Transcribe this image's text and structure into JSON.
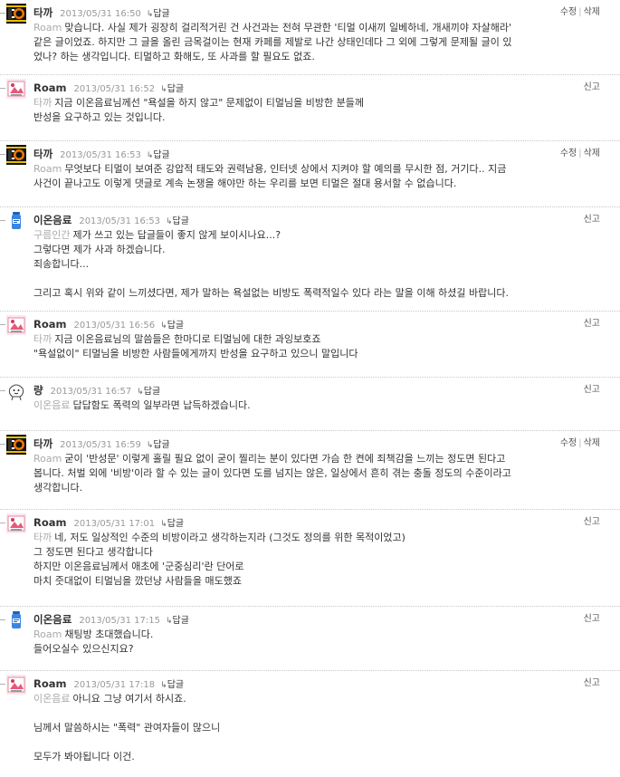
{
  "comments": [
    {
      "nick": "타까",
      "avatar": "taka-avatar",
      "date": "2013/05/31 16:50",
      "reply": "답글",
      "actions": [
        "수정",
        "삭제"
      ],
      "ref": "Roam",
      "lines": [
        "맞습니다. 사실 제가 굉장히 걸리적거린 건 사건과는 전혀 무관한 '티멀 이새끼 일베하네, 개새끼야 자살해라'",
        "같은 글이었죠. 하지만 그 글을 올린 금목걸이는 현재 카페를 제발로 나간 상태인데다 그 외에 그렇게 문제될 글이 있",
        "었나? 하는 생각입니다. 티멀하고 화해도, 또 사과를 할 필요도 없죠."
      ]
    },
    {
      "nick": "Roam",
      "avatar": "roam-avatar",
      "date": "2013/05/31 16:52",
      "reply": "답글",
      "actions": [
        "신고"
      ],
      "ref": "타까",
      "lines": [
        "지금 이온음료님께선 \"욕설을 하지 않고\" 문제없이 티멀님을 비방한 분들께",
        "반성을 요구하고 있는 것입니다."
      ]
    },
    {
      "nick": "타까",
      "avatar": "taka-avatar",
      "date": "2013/05/31 16:53",
      "reply": "답글",
      "actions": [
        "수정",
        "삭제"
      ],
      "ref": "Roam",
      "lines": [
        "무엇보다 티멀이 보여준 강압적 태도와 권력남용, 인터넷 상에서 지켜야 할 예의를 무시한 점, 거기다.. 지금",
        "사건이 끝나고도 이렇게 댓글로 계속 논쟁을 해야만 하는 우리를 보면 티멀은 절대 용서할 수 없습니다."
      ]
    },
    {
      "nick": "이온음료",
      "avatar": "ion-avatar",
      "date": "2013/05/31 16:53",
      "reply": "답글",
      "actions": [
        "신고"
      ],
      "ref": "구름인간",
      "lines": [
        "제가 쓰고 있는 답글들이 좋지 않게 보이시나요...?",
        "그렇다면 제가 사과 하겠습니다.",
        "죄송합니다...",
        "",
        "그리고 혹시 위와 같이 느끼셨다면, 제가 말하는 욕설없는 비방도 폭력적일수 있다 라는 말을 이해 하셨길 바랍니다."
      ]
    },
    {
      "nick": "Roam",
      "avatar": "roam-avatar",
      "date": "2013/05/31 16:56",
      "reply": "답글",
      "actions": [
        "신고"
      ],
      "ref": "타까",
      "lines": [
        "지금 이온음료님의 말씀들은 한마디로 티멀님에 대한 과잉보호죠",
        "\"욕설없이\" 티멀님을 비방한 사람들에게까지 반성을 요구하고 있으니 말입니다"
      ]
    },
    {
      "nick": "량",
      "avatar": "ryang-avatar",
      "date": "2013/05/31 16:57",
      "reply": "답글",
      "actions": [
        "신고"
      ],
      "ref": "이온음료",
      "lines": [
        "답답함도 폭력의 일부라면 납득하겠습니다."
      ]
    },
    {
      "nick": "타까",
      "avatar": "taka-avatar",
      "date": "2013/05/31 16:59",
      "reply": "답글",
      "actions": [
        "수정",
        "삭제"
      ],
      "ref": "Roam",
      "lines": [
        "굳이 '반성문' 이렇게 홀릴 필요 없이 굳이 찔리는 분이 있다면 가슴 한 켠에 죄책감을 느끼는 정도면 된다고",
        "봅니다. 처벌 외에 '비방'이라 할 수 있는 글이 있다면 도를 넘지는 않은, 일상에서 흔히 겪는 충돌 정도의 수준이라고",
        "생각합니다."
      ]
    },
    {
      "nick": "Roam",
      "avatar": "roam-avatar",
      "date": "2013/05/31 17:01",
      "reply": "답글",
      "actions": [
        "신고"
      ],
      "ref": "타까",
      "lines": [
        "네, 저도 일상적인 수준의 비방이라고 생각하는지라 (그것도 정의를 위한 목적이었고)",
        "그 정도면 된다고 생각합니다",
        "하지만 이온음료님께서 애초에 '군중심리'란 단어로",
        "마치 줏대없이 티멀님을 깠던냥 사람들을 매도했죠"
      ]
    },
    {
      "nick": "이온음료",
      "avatar": "ion-avatar",
      "date": "2013/05/31 17:15",
      "reply": "답글",
      "actions": [
        "신고"
      ],
      "ref": "Roam",
      "lines": [
        "채팅방 초대했습니다.",
        "들어오실수 있으신지요?"
      ]
    },
    {
      "nick": "Roam",
      "avatar": "roam-avatar",
      "date": "2013/05/31 17:18",
      "reply": "답글",
      "actions": [
        "신고"
      ],
      "ref": "이온음료",
      "lines": [
        "아니요 그냥 여기서 하시죠.",
        "",
        "님께서 말씀하시는 \"폭력\" 관여자들이 많으니",
        "",
        "모두가 봐야됩니다 이건."
      ]
    }
  ]
}
